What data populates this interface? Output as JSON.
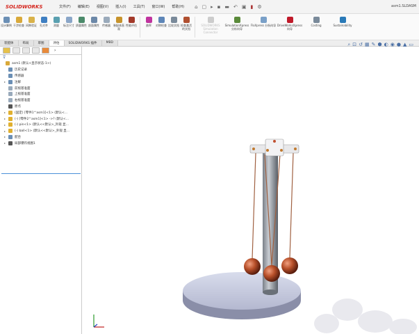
{
  "app": {
    "logo": "SOLIDWORKS",
    "doc_title": "asm1.SLDASM"
  },
  "menu": [
    "文件(F)",
    "编辑(E)",
    "视图(V)",
    "插入(I)",
    "工具(T)",
    "窗口(W)",
    "帮助(H)"
  ],
  "toolbar": [
    {
      "label": "设计算例",
      "color": "#6b8fb5"
    },
    {
      "label": "干涉检查",
      "color": "#d9a93a"
    },
    {
      "label": "间隙验证",
      "color": "#d9b24a"
    },
    {
      "label": "孔对齐",
      "color": "#3f7fc2"
    },
    {
      "label": "测量",
      "color": "#5aa0b0"
    },
    {
      "label": "标注尺寸",
      "color": "#8aa6c8"
    },
    {
      "label": "质量属性",
      "color": "#4b8a6a"
    },
    {
      "label": "剖面属性",
      "color": "#6c88a8"
    },
    {
      "label": "传感器",
      "color": "#9aaabb"
    },
    {
      "label": "装配体直观",
      "color": "#c7932b"
    },
    {
      "label": "性能评估",
      "color": "#a33a2a"
    },
    {
      "label": "曲率",
      "color": "#c0339f"
    },
    {
      "label": "对称检查",
      "color": "#5e86b8"
    },
    {
      "label": "比较文档",
      "color": "#7a8a9a"
    },
    {
      "label": "检查激活的文档",
      "color": "#b05030"
    },
    {
      "label": "SOLIDWORKS Simulation Connector",
      "color": "#cccccc",
      "disabled": true
    },
    {
      "label": "SimulationXpress 分析向导",
      "color": "#5a8a3a"
    },
    {
      "label": "FloXpress 分析向导",
      "color": "#7aa0c8"
    },
    {
      "label": "DriveWorksXpress 向导",
      "color": "#c01a2a"
    },
    {
      "label": "Costing",
      "color": "#7a8a9a"
    },
    {
      "label": "Sustainability",
      "color": "#2a7ab8"
    }
  ],
  "tabs": [
    {
      "label": "装配体"
    },
    {
      "label": "布局"
    },
    {
      "label": "草图"
    },
    {
      "label": "评估",
      "active": true
    },
    {
      "label": "SOLIDWORKS 插件"
    },
    {
      "label": "MBD"
    }
  ],
  "view_tools": [
    "search-icon",
    "zoom-area-icon",
    "previous-view-icon",
    "section-view-icon",
    "dynamic-annotation-icon",
    "view-orientation-icon",
    "display-style-icon",
    "hide-show-icon",
    "edit-appearance-icon",
    "scene-icon",
    "view-settings-icon"
  ],
  "tree": [
    {
      "label": "asm1 (默认<显示状态-1>)",
      "color": "#d9a93a",
      "level": 0
    },
    {
      "label": "历史记录",
      "color": "#6b8fb5",
      "level": 1
    },
    {
      "label": "传感器",
      "color": "#6b8fb5",
      "level": 1
    },
    {
      "label": "注解",
      "color": "#6b8fb5",
      "level": 1,
      "expand": true
    },
    {
      "label": "前视基准面",
      "color": "#9ab",
      "level": 1
    },
    {
      "label": "上视基准面",
      "color": "#9ab",
      "level": 1
    },
    {
      "label": "右视基准面",
      "color": "#9ab",
      "level": 1
    },
    {
      "label": "原点",
      "color": "#555",
      "level": 1
    },
    {
      "label": "(固定) [零件1^asm1]<1> (默认<...",
      "color": "#e0b030",
      "level": 1,
      "expand": true
    },
    {
      "label": "(-) [零件2^asm1]<1> ->? (默认<...",
      "color": "#e0b030",
      "level": 1,
      "expand": true
    },
    {
      "label": "(-) pin<1> (默认<<默认>_外观 显...",
      "color": "#e0b030",
      "level": 1,
      "expand": true
    },
    {
      "label": "(-) ball<1> (默认<<默认>_外观 显...",
      "color": "#e0b030",
      "level": 1,
      "expand": true
    },
    {
      "label": "配合",
      "color": "#6b8fb5",
      "level": 1,
      "expand": true
    },
    {
      "label": "局部爆炸视图1",
      "color": "#555",
      "level": 1,
      "expand": true
    }
  ]
}
